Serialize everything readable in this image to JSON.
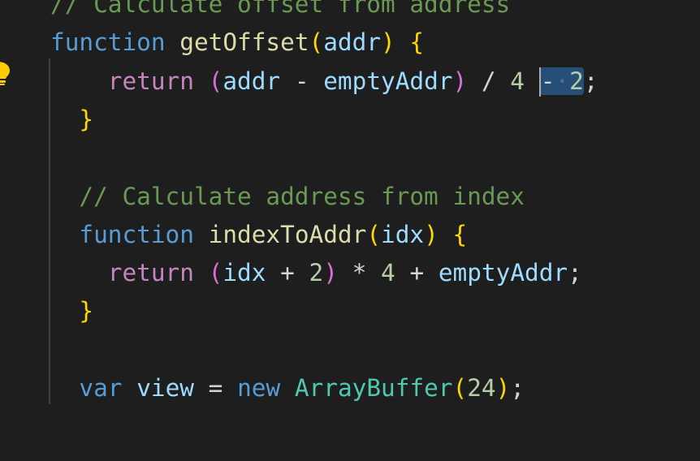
{
  "editor": {
    "lines": [
      {
        "tokens": [
          {
            "t": "// Calculate offset from address",
            "c": "cmt"
          }
        ]
      },
      {
        "tokens": [
          {
            "t": "function",
            "c": "kw-blue"
          },
          {
            "t": " ",
            "c": "op"
          },
          {
            "t": "getOffset",
            "c": "fn"
          },
          {
            "t": "(",
            "c": "br1"
          },
          {
            "t": "addr",
            "c": "param"
          },
          {
            "t": ")",
            "c": "br1"
          },
          {
            "t": " ",
            "c": "op"
          },
          {
            "t": "{",
            "c": "br1"
          }
        ]
      },
      {
        "tokens": [
          {
            "t": "    ",
            "c": "op"
          },
          {
            "t": "return",
            "c": "kw-pink"
          },
          {
            "t": " ",
            "c": "op"
          },
          {
            "t": "(",
            "c": "br2"
          },
          {
            "t": "addr",
            "c": "param"
          },
          {
            "t": " - ",
            "c": "op"
          },
          {
            "t": "emptyAddr",
            "c": "param"
          },
          {
            "t": ")",
            "c": "br2"
          },
          {
            "t": " / ",
            "c": "op"
          },
          {
            "t": "4",
            "c": "num"
          },
          {
            "t": " ",
            "c": "op"
          }
        ],
        "selection": {
          "before": "-",
          "ws": "·",
          "num": "2"
        },
        "tail": ";"
      },
      {
        "tokens": [
          {
            "t": "  ",
            "c": "op"
          },
          {
            "t": "}",
            "c": "br1"
          }
        ]
      },
      {
        "tokens": []
      },
      {
        "tokens": [
          {
            "t": "  ",
            "c": "op"
          },
          {
            "t": "// Calculate address from index",
            "c": "cmt"
          }
        ]
      },
      {
        "tokens": [
          {
            "t": "  ",
            "c": "op"
          },
          {
            "t": "function",
            "c": "kw-blue"
          },
          {
            "t": " ",
            "c": "op"
          },
          {
            "t": "indexToAddr",
            "c": "fn"
          },
          {
            "t": "(",
            "c": "br1"
          },
          {
            "t": "idx",
            "c": "param"
          },
          {
            "t": ")",
            "c": "br1"
          },
          {
            "t": " ",
            "c": "op"
          },
          {
            "t": "{",
            "c": "br1"
          }
        ]
      },
      {
        "tokens": [
          {
            "t": "    ",
            "c": "op"
          },
          {
            "t": "return",
            "c": "kw-pink"
          },
          {
            "t": " ",
            "c": "op"
          },
          {
            "t": "(",
            "c": "br2"
          },
          {
            "t": "idx",
            "c": "param"
          },
          {
            "t": " + ",
            "c": "op"
          },
          {
            "t": "2",
            "c": "num"
          },
          {
            "t": ")",
            "c": "br2"
          },
          {
            "t": " * ",
            "c": "op"
          },
          {
            "t": "4",
            "c": "num"
          },
          {
            "t": " + ",
            "c": "op"
          },
          {
            "t": "emptyAddr",
            "c": "param"
          },
          {
            "t": ";",
            "c": "op"
          }
        ]
      },
      {
        "tokens": [
          {
            "t": "  ",
            "c": "op"
          },
          {
            "t": "}",
            "c": "br1"
          }
        ]
      },
      {
        "tokens": []
      },
      {
        "tokens": [
          {
            "t": "  ",
            "c": "op"
          },
          {
            "t": "var",
            "c": "kw-blue"
          },
          {
            "t": " ",
            "c": "op"
          },
          {
            "t": "view",
            "c": "param"
          },
          {
            "t": " = ",
            "c": "op"
          },
          {
            "t": "new",
            "c": "kw-blue"
          },
          {
            "t": " ",
            "c": "op"
          },
          {
            "t": "ArrayBuffer",
            "c": "cls"
          },
          {
            "t": "(",
            "c": "br1"
          },
          {
            "t": "24",
            "c": "num"
          },
          {
            "t": ")",
            "c": "br1"
          },
          {
            "t": ";",
            "c": "op"
          }
        ]
      }
    ]
  },
  "colors": {
    "background": "#1e1e1e",
    "selection": "#264f78",
    "lightbulb": "#ffcc00"
  },
  "icons": {
    "lightbulb": "lightbulb-icon"
  }
}
